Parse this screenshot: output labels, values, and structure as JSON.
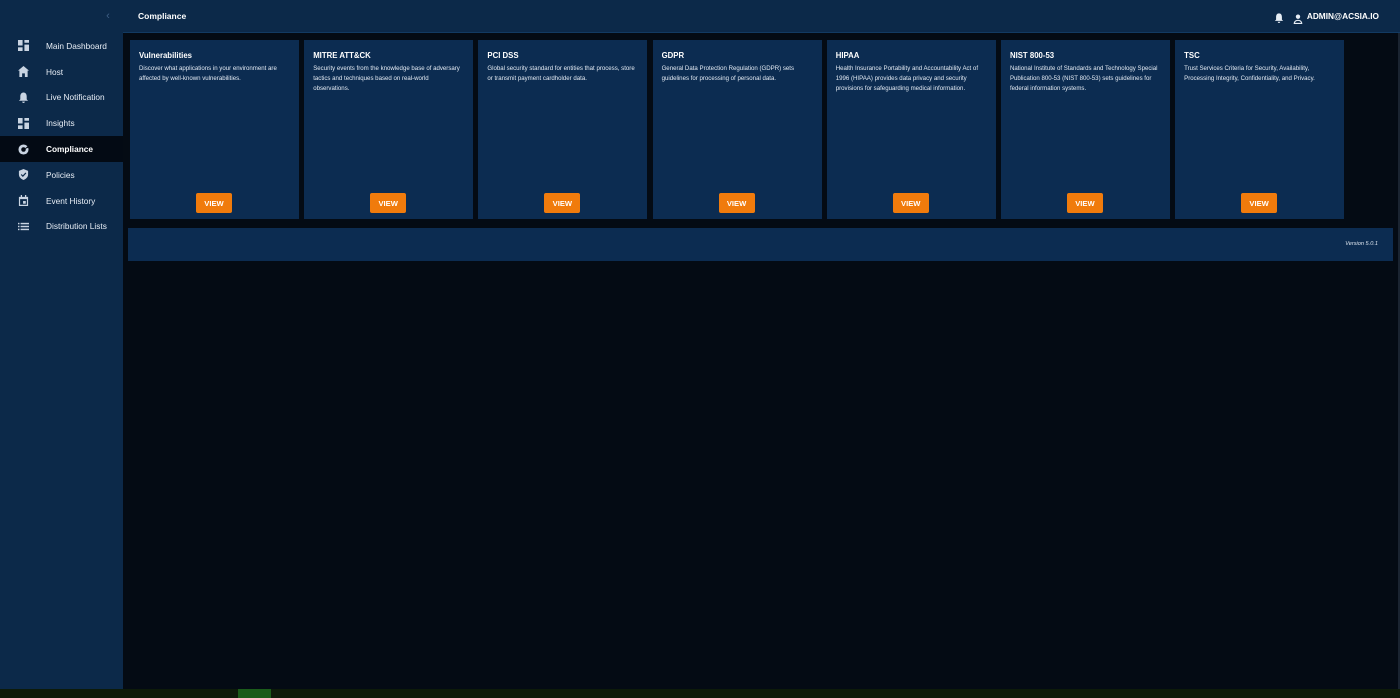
{
  "header": {
    "title": "Compliance",
    "user": "ADMIN@ACSIA.IO"
  },
  "sidebar": {
    "collapse": "‹",
    "items": [
      {
        "label": "Main Dashboard",
        "icon": "dashboard-icon"
      },
      {
        "label": "Host",
        "icon": "home-icon"
      },
      {
        "label": "Live Notification",
        "icon": "bell-icon"
      },
      {
        "label": "Insights",
        "icon": "insights-icon"
      },
      {
        "label": "Compliance",
        "icon": "compliance-icon",
        "active": true
      },
      {
        "label": "Policies",
        "icon": "shield-icon"
      },
      {
        "label": "Event History",
        "icon": "calendar-icon"
      },
      {
        "label": "Distribution Lists",
        "icon": "list-icon"
      }
    ]
  },
  "cards": [
    {
      "title": "Vulnerabilities",
      "desc": "Discover what applications in your environment are affected by well-known vulnerabilities.",
      "button": "VIEW"
    },
    {
      "title": "MITRE ATT&CK",
      "desc": "Security events from the knowledge base of adversary tactics and techniques based on real-world observations.",
      "button": "VIEW"
    },
    {
      "title": "PCI DSS",
      "desc": "Global security standard for entities that process, store or transmit payment cardholder data.",
      "button": "VIEW"
    },
    {
      "title": "GDPR",
      "desc": "General Data Protection Regulation (GDPR) sets guidelines for processing of personal data.",
      "button": "VIEW"
    },
    {
      "title": "HIPAA",
      "desc": "Health Insurance Portability and Accountability Act of 1996 (HIPAA) provides data privacy and security provisions for safeguarding medical information.",
      "button": "VIEW"
    },
    {
      "title": "NIST 800-53",
      "desc": "National Institute of Standards and Technology Special Publication 800-53 (NIST 800-53) sets guidelines for federal information systems.",
      "button": "VIEW"
    },
    {
      "title": "TSC",
      "desc": "Trust Services Criteria for Security, Availability, Processing Integrity, Confidentiality, and Privacy.",
      "button": "VIEW"
    }
  ],
  "footer": {
    "version": "Version 5.0.1"
  },
  "colors": {
    "accent": "#f07b0c",
    "panel": "#0c2c51",
    "sidebar": "#0c2949",
    "background": "#040b14"
  }
}
